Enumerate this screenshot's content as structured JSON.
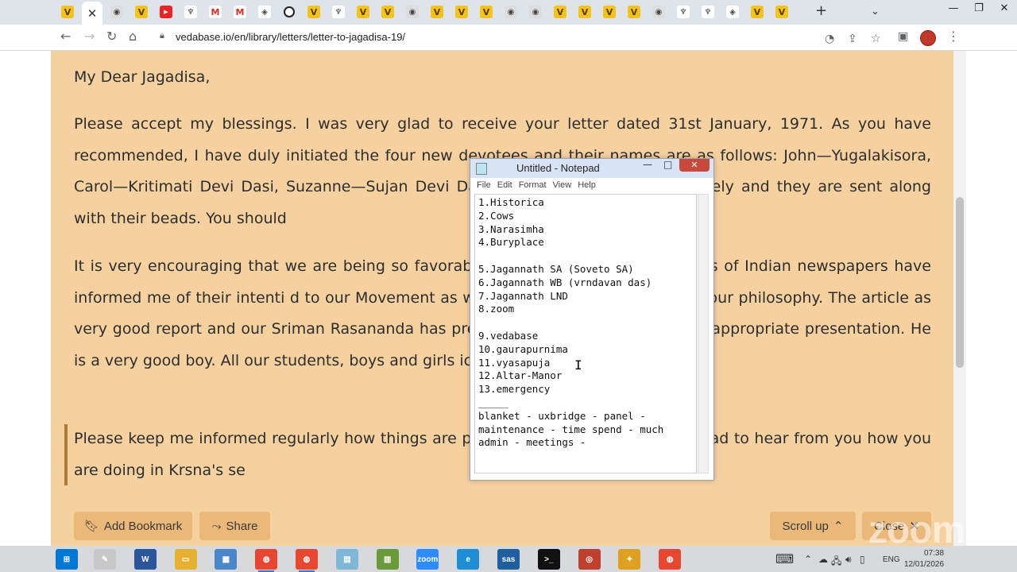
{
  "browser": {
    "url": "vedabase.io/en/library/letters/letter-to-jagadisa-19/",
    "tabs": [
      {
        "icon": "vedabase-icon",
        "glyph": "V"
      },
      {
        "icon": "close-icon",
        "glyph": "✕",
        "active": true
      },
      {
        "icon": "github-icon",
        "glyph": "◉"
      },
      {
        "icon": "vedabase-icon",
        "glyph": "V"
      },
      {
        "icon": "youtube-icon",
        "glyph": "▶"
      },
      {
        "icon": "trophy-icon",
        "glyph": "♆"
      },
      {
        "icon": "gmail-icon",
        "glyph": "M"
      },
      {
        "icon": "gmail-icon",
        "glyph": "M"
      },
      {
        "icon": "colorful-icon",
        "glyph": "◈"
      },
      {
        "icon": "circle-icon",
        "glyph": "o"
      },
      {
        "icon": "vedabase-icon",
        "glyph": "V"
      },
      {
        "icon": "trophy-icon",
        "glyph": "♆"
      },
      {
        "icon": "vedabase-icon",
        "glyph": "V"
      },
      {
        "icon": "vedabase-icon",
        "glyph": "V"
      },
      {
        "icon": "github-icon",
        "glyph": "◉"
      },
      {
        "icon": "vedabase-icon",
        "glyph": "V"
      },
      {
        "icon": "vedabase-icon",
        "glyph": "V"
      },
      {
        "icon": "vedabase-icon",
        "glyph": "V"
      },
      {
        "icon": "github-icon",
        "glyph": "◉"
      },
      {
        "icon": "github-icon",
        "glyph": "◉"
      },
      {
        "icon": "vedabase-icon",
        "glyph": "V"
      },
      {
        "icon": "vedabase-icon",
        "glyph": "V"
      },
      {
        "icon": "vedabase-icon",
        "glyph": "V"
      },
      {
        "icon": "vedabase-icon",
        "glyph": "V"
      },
      {
        "icon": "github-icon",
        "glyph": "◉"
      },
      {
        "icon": "trophy-icon",
        "glyph": "♆"
      },
      {
        "icon": "trophy-icon",
        "glyph": "♆"
      },
      {
        "icon": "colorful-icon",
        "glyph": "◈"
      },
      {
        "icon": "vedabase-icon",
        "glyph": "V"
      },
      {
        "icon": "vedabase-icon",
        "glyph": "V"
      }
    ]
  },
  "letter": {
    "salutation": "My Dear Jagadisa,",
    "p1": "Please accept my blessings. I was very glad to receive your letter dated 31st January, 1971. As you have recommended, I have duly initiated the four new devotees and their names are as follows: John—Yugalakisora, Carol—Kritimati Devi Dasi, Suzanne—Sujan Devi Dasi                                                                       replied their letters separately and they are sent along with their beads. You should",
    "p2": "It is very encouraging that we are being so favorably                                                                          media. Just today two editors of Indian newspapers have informed me of their intenti                                                    d to our Movement as well as give daily one article on our philosophy. The article                                                       as very good report and our Sriman Rasananda has presented the facts very well.                                                            his appropriate presentation. He is a very good boy. All our students, boys and girls                                                                       ice process.",
    "p3": "Please keep me informed regularly how things are p                                                        your zone. I am always very glad to hear from you how you are doing in Krsna's se"
  },
  "actions": {
    "bookmark": "Add Bookmark",
    "share": "Share",
    "scroll_up": "Scroll up",
    "close": "Close"
  },
  "notepad": {
    "title": "Untitled - Notepad",
    "menu": [
      "File",
      "Edit",
      "Format",
      "View",
      "Help"
    ],
    "text": "1.Historica\n2.Cows\n3.Narasimha\n4.Buryplace\n\n5.Jagannath SA (Soveto SA)\n6.Jagannath WB (vrndavan das)\n7.Jagannath LND\n8.zoom\n\n9.vedabase\n10.gaurapurnima\n11.vyasapuja\n12.Altar-Manor\n13.emergency\n_____\nblanket - uxbridge - panel -\nmaintenance - time spend - much\nadmin - meetings -"
  },
  "taskbar": {
    "lang": "ENG",
    "time": "07:38",
    "date": "12/01/2026",
    "apps": [
      {
        "name": "start-button",
        "color": "#0078d7",
        "glyph": "⊞"
      },
      {
        "name": "paint-app",
        "color": "#c8c8c8",
        "glyph": "✎"
      },
      {
        "name": "word-app",
        "color": "#2b579a",
        "glyph": "W"
      },
      {
        "name": "explorer-app",
        "color": "#e8b030",
        "glyph": "▭"
      },
      {
        "name": "control-panel-app",
        "color": "#4a87c8",
        "glyph": "▦"
      },
      {
        "name": "chrome-app",
        "color": "#e9462f",
        "glyph": "◍"
      },
      {
        "name": "chrome-app-2",
        "color": "#e9462f",
        "glyph": "◍"
      },
      {
        "name": "notepad-app",
        "color": "#7fb8d6",
        "glyph": "▤"
      },
      {
        "name": "winrar-app",
        "color": "#6a9a3a",
        "glyph": "▥"
      },
      {
        "name": "zoom-app",
        "color": "#2d8cff",
        "glyph": "zoom"
      },
      {
        "name": "edge-app",
        "color": "#1e8fd6",
        "glyph": "e"
      },
      {
        "name": "sas-app",
        "color": "#1f5fa0",
        "glyph": "sas"
      },
      {
        "name": "terminal-app",
        "color": "#111111",
        "glyph": ">_"
      },
      {
        "name": "compass-app",
        "color": "#c04030",
        "glyph": "◎"
      },
      {
        "name": "photos-app",
        "color": "#e0a020",
        "glyph": "✦"
      },
      {
        "name": "chrome-app-3",
        "color": "#e9462f",
        "glyph": "◍"
      }
    ]
  },
  "watermark": "zoom"
}
